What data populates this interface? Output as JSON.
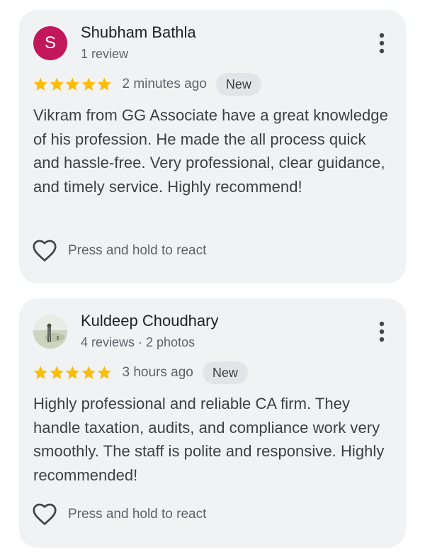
{
  "colors": {
    "star": "#fbbc04",
    "avatar_letter_bg": "#c2185b",
    "card_bg": "#f1f2f4",
    "badge_bg": "#e2e4e8"
  },
  "reviews": [
    {
      "avatar_letter": "S",
      "avatar_type": "letter",
      "name": "Shubham Bathla",
      "meta": "1 review",
      "rating": 5,
      "time": "2 minutes ago",
      "badge": "New",
      "text": "Vikram from GG Associate have a great knowledge of his profession. He made the all process quick and hassle-free. Very professional, clear guidance, and timely service. Highly recommend!",
      "react_label": "Press and hold to react",
      "icons": {
        "more": "more-vert-icon",
        "react": "heart-outline-icon",
        "star": "star-icon"
      }
    },
    {
      "avatar_type": "photo",
      "name": "Kuldeep Choudhary",
      "meta": "4 reviews · 2 photos",
      "rating": 5,
      "time": "3 hours ago",
      "badge": "New",
      "text": "Highly professional and reliable CA firm. They handle taxation, audits, and compliance work very smoothly. The staff is polite and responsive. Highly recommended!",
      "react_label": "Press and hold to react",
      "icons": {
        "more": "more-vert-icon",
        "react": "heart-outline-icon",
        "star": "star-icon"
      }
    }
  ]
}
